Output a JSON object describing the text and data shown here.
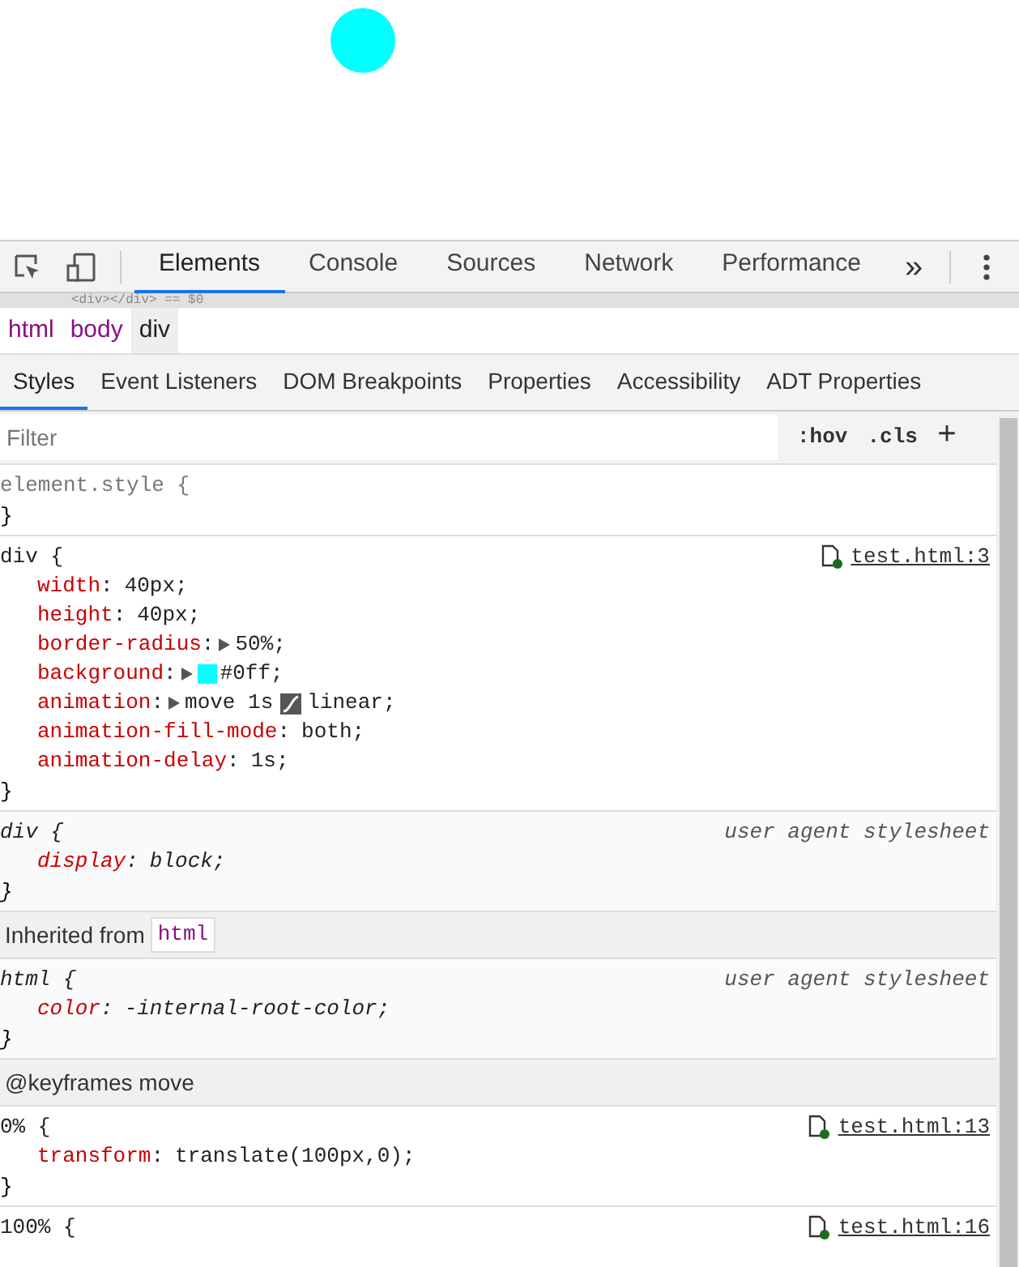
{
  "toolbar": {
    "tabs": [
      {
        "label": "Elements",
        "selected": true
      },
      {
        "label": "Console",
        "selected": false
      },
      {
        "label": "Sources",
        "selected": false
      },
      {
        "label": "Network",
        "selected": false
      },
      {
        "label": "Performance",
        "selected": false
      }
    ],
    "overflow": "»"
  },
  "dom_line": "<div></div> == $0",
  "breadcrumbs": [
    {
      "label": "html",
      "selected": false
    },
    {
      "label": "body",
      "selected": false
    },
    {
      "label": "div",
      "selected": true
    }
  ],
  "subtabs": [
    {
      "label": "Styles",
      "selected": true
    },
    {
      "label": "Event Listeners",
      "selected": false
    },
    {
      "label": "DOM Breakpoints",
      "selected": false
    },
    {
      "label": "Properties",
      "selected": false
    },
    {
      "label": "Accessibility",
      "selected": false
    },
    {
      "label": "ADT Properties",
      "selected": false
    }
  ],
  "filter": {
    "placeholder": "Filter",
    "buttons": [
      ":hov",
      ".cls",
      "+"
    ]
  },
  "rules": [
    {
      "kind": "rule",
      "selector": "element.style {",
      "user_agent": false,
      "close": "}"
    },
    {
      "kind": "rule",
      "selector": "div {",
      "user_agent": false,
      "origin": "test.html:3",
      "properties": [
        {
          "name": "width",
          "separator": ":",
          "value": "40px;"
        },
        {
          "name": "height",
          "separator": ":",
          "value": "40px;"
        },
        {
          "name": "border-radius",
          "separator": ":",
          "expandable": true,
          "value": "50%;"
        },
        {
          "name": "background",
          "separator": ":",
          "expandable": true,
          "color": "#00ffff",
          "value": "#0ff;"
        },
        {
          "name": "animation",
          "separator": ":",
          "expandable": true,
          "value": "move 1s",
          "easing_value": "linear;"
        },
        {
          "name": "animation-fill-mode",
          "separator": ":",
          "value": "both;"
        },
        {
          "name": "animation-delay",
          "separator": ":",
          "value": "1s;"
        }
      ],
      "close": "}"
    },
    {
      "kind": "rule",
      "selector": "div {",
      "user_agent": true,
      "origin": "user agent stylesheet",
      "properties": [
        {
          "name": "display",
          "separator": ":",
          "value": "block;"
        }
      ],
      "close": "}"
    },
    {
      "kind": "header",
      "text": "Inherited from",
      "tag": "html"
    },
    {
      "kind": "rule",
      "selector": "html {",
      "user_agent": true,
      "origin": "user agent stylesheet",
      "properties": [
        {
          "name": "color",
          "separator": ":",
          "value": "-internal-root-color;"
        }
      ],
      "close": "}"
    },
    {
      "kind": "header",
      "text": "@keyframes move"
    },
    {
      "kind": "rule",
      "selector": "0% {",
      "user_agent": false,
      "origin": "test.html:13",
      "properties": [
        {
          "name": "transform",
          "separator": ":",
          "value": "translate(100px,0);"
        }
      ],
      "close": "}"
    },
    {
      "kind": "rule",
      "selector": "100% {",
      "user_agent": false,
      "origin": "test.html:16"
    }
  ]
}
